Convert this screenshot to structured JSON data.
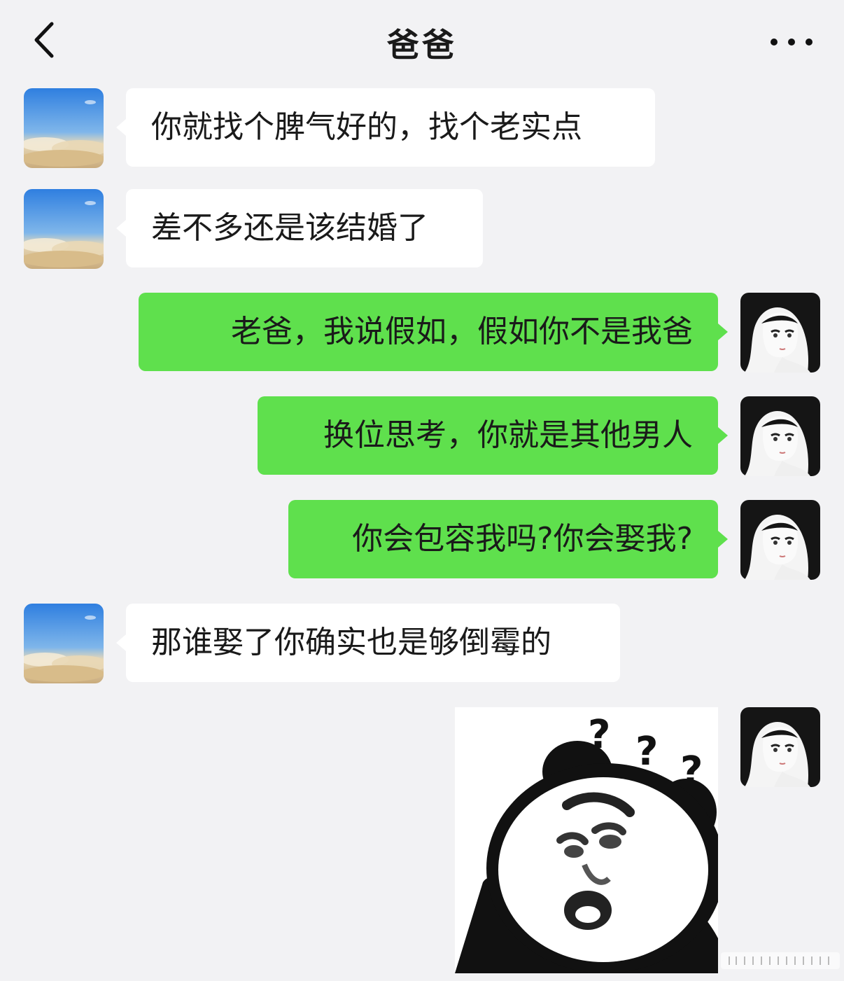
{
  "header": {
    "title": "爸爸",
    "back_icon": "chevron-left-icon",
    "more_icon": "more-dots-icon"
  },
  "colors": {
    "background": "#f2f2f4",
    "incoming_bubble": "#ffffff",
    "outgoing_bubble": "#5fe04d"
  },
  "messages": [
    {
      "sender": "dad",
      "text": "你就找个脾气好的，找个老实点"
    },
    {
      "sender": "dad",
      "text": "差不多还是该结婚了"
    },
    {
      "sender": "me",
      "text": "老爸，我说假如，假如你不是我爸"
    },
    {
      "sender": "me",
      "text": "换位思考，你就是其他男人"
    },
    {
      "sender": "me",
      "text": "你会包容我吗?你会娶我?"
    },
    {
      "sender": "dad",
      "text": "那谁娶了你确实也是够倒霉的"
    },
    {
      "sender": "me",
      "type": "sticker",
      "sticker": "panda-meme-question-marks",
      "sticker_text": "? ? ?"
    }
  ]
}
